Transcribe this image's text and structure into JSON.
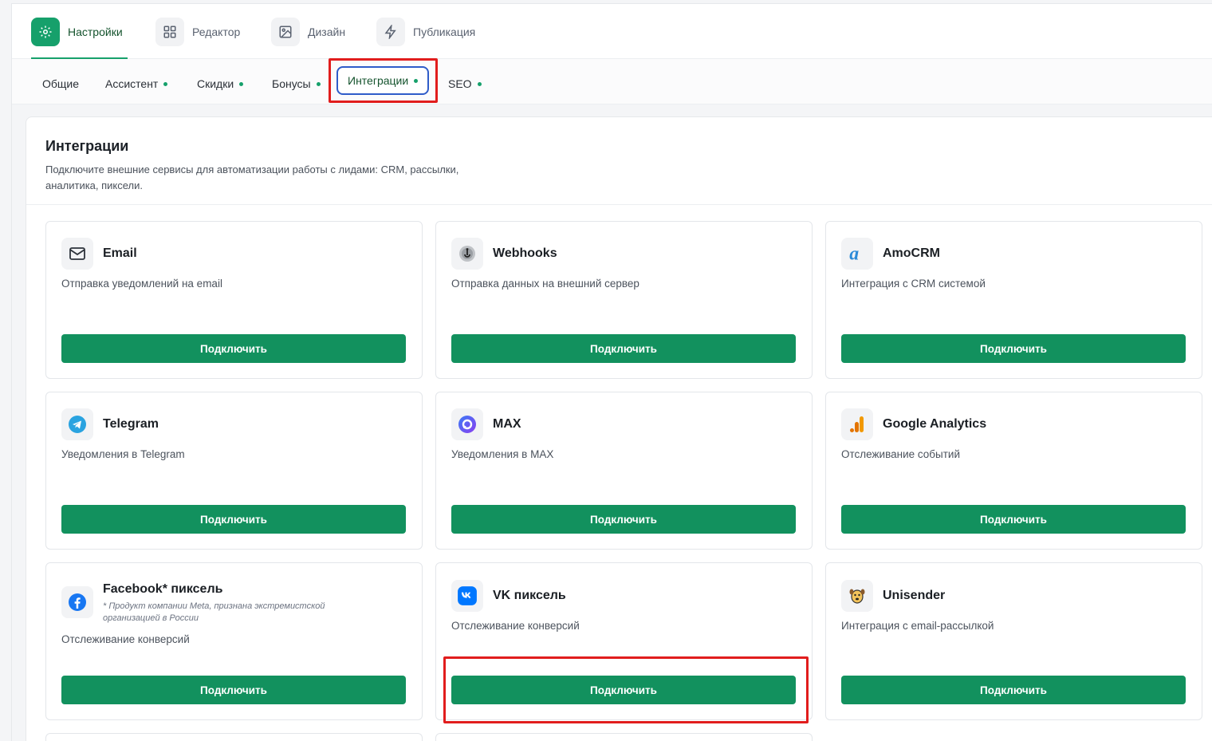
{
  "top_tabs": [
    {
      "label": "Настройки",
      "icon": "gear-icon",
      "active": true
    },
    {
      "label": "Редактор",
      "icon": "grid-icon",
      "active": false
    },
    {
      "label": "Дизайн",
      "icon": "image-icon",
      "active": false
    },
    {
      "label": "Публикация",
      "icon": "lightning-icon",
      "active": false
    }
  ],
  "sub_tabs": [
    {
      "label": "Общие",
      "dot": false
    },
    {
      "label": "Ассистент",
      "dot": true
    },
    {
      "label": "Скидки",
      "dot": true
    },
    {
      "label": "Бонусы",
      "dot": true
    },
    {
      "label": "Интеграции",
      "dot": true,
      "active": true
    },
    {
      "label": "SEO",
      "dot": true
    }
  ],
  "panel": {
    "title": "Интеграции",
    "description": "Подключите внешние сервисы для автоматизации работы с лидами: CRM, рассылки, аналитика, пиксели."
  },
  "cards": [
    {
      "name": "Email",
      "description": "Отправка уведомлений на email",
      "button": "Подключить",
      "icon": "mail-icon"
    },
    {
      "name": "Webhooks",
      "description": "Отправка данных на внешний сервер",
      "button": "Подключить",
      "icon": "webhook-icon"
    },
    {
      "name": "AmoCRM",
      "description": "Интеграция с CRM системой",
      "button": "Подключить",
      "icon": "amocrm-icon"
    },
    {
      "name": "Telegram",
      "description": "Уведомления в Telegram",
      "button": "Подключить",
      "icon": "telegram-icon"
    },
    {
      "name": "MAX",
      "description": "Уведомления в MAX",
      "button": "Подключить",
      "icon": "max-icon"
    },
    {
      "name": "Google Analytics",
      "description": "Отслеживание событий",
      "button": "Подключить",
      "icon": "google-analytics-icon"
    },
    {
      "name": "Facebook* пиксель",
      "note": "* Продукт компании Meta, признана экстремистской организацией в России",
      "description": "Отслеживание конверсий",
      "button": "Подключить",
      "icon": "facebook-icon"
    },
    {
      "name": "VK пиксель",
      "description": "Отслеживание конверсий",
      "button": "Подключить",
      "icon": "vk-icon"
    },
    {
      "name": "Unisender",
      "description": "Интеграция с email-рассылкой",
      "button": "Подключить",
      "icon": "unisender-icon"
    }
  ],
  "colors": {
    "brand": "#12915e",
    "accent": "#16a06b",
    "highlight": "#e11d1d",
    "active_tab_border": "#2f5cc9"
  }
}
